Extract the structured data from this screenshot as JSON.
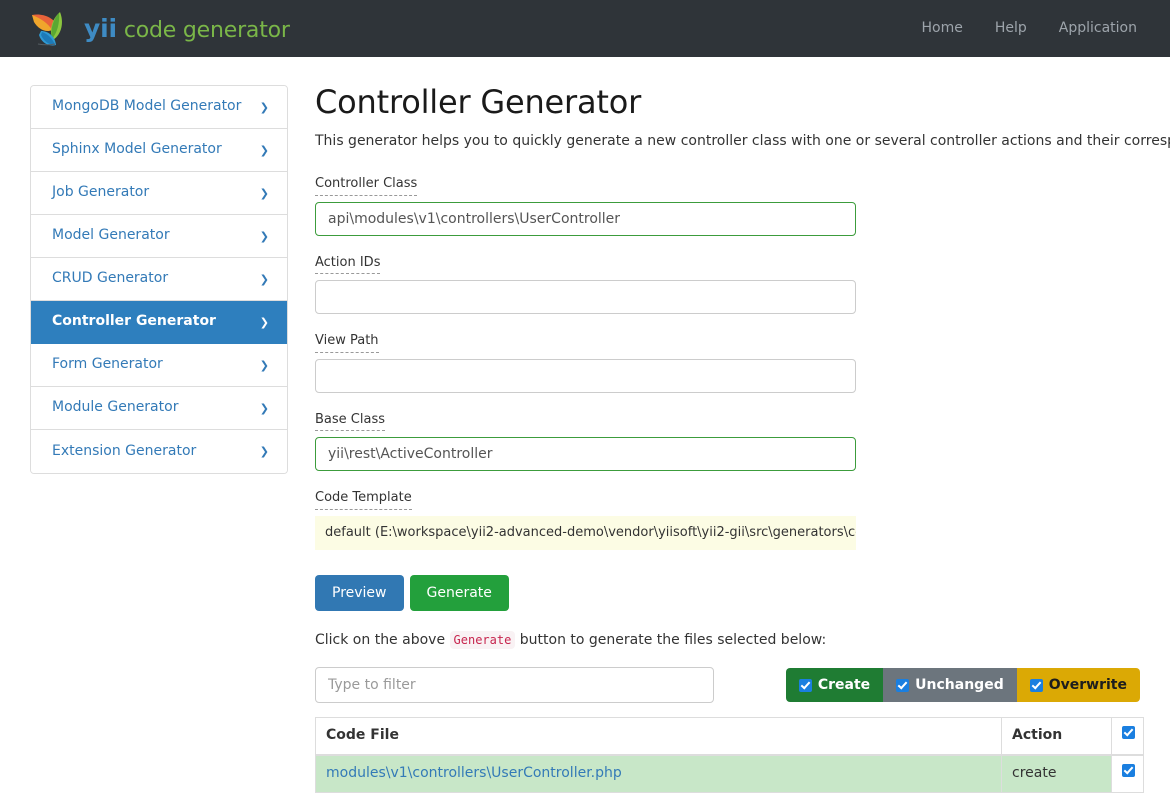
{
  "header": {
    "brand_yii": "yii",
    "brand_suffix": "code generator",
    "logo_icon": "yii-bird-logo",
    "nav": [
      {
        "label": "Home",
        "name": "nav-home"
      },
      {
        "label": "Help",
        "name": "nav-help"
      },
      {
        "label": "Application",
        "name": "nav-application"
      }
    ]
  },
  "sidebar": {
    "items": [
      {
        "label": "MongoDB Model Generator",
        "active": false
      },
      {
        "label": "Sphinx Model Generator",
        "active": false
      },
      {
        "label": "Job Generator",
        "active": false
      },
      {
        "label": "Model Generator",
        "active": false
      },
      {
        "label": "CRUD Generator",
        "active": false
      },
      {
        "label": "Controller Generator",
        "active": true
      },
      {
        "label": "Form Generator",
        "active": false
      },
      {
        "label": "Module Generator",
        "active": false
      },
      {
        "label": "Extension Generator",
        "active": false
      }
    ],
    "chevron_icon": "chevron-right-icon"
  },
  "main": {
    "title": "Controller Generator",
    "description": "This generator helps you to quickly generate a new controller class with one or several controller actions and their corresponding views.",
    "fields": [
      {
        "label": "Controller Class",
        "value": "api\\modules\\v1\\controllers\\UserController",
        "placeholder": "",
        "valid": true
      },
      {
        "label": "Action IDs",
        "value": "",
        "placeholder": "",
        "valid": false
      },
      {
        "label": "View Path",
        "value": "",
        "placeholder": "",
        "valid": false
      },
      {
        "label": "Base Class",
        "value": "yii\\rest\\ActiveController",
        "placeholder": "",
        "valid": true
      }
    ],
    "code_template": {
      "label": "Code Template",
      "value": "default (E:\\workspace\\yii2-advanced-demo\\vendor\\yiisoft\\yii2-gii\\src\\generators\\con…"
    },
    "buttons": {
      "preview": "Preview",
      "generate": "Generate"
    },
    "hint": {
      "prefix": "Click on the above ",
      "code": "Generate",
      "suffix": " button to generate the files selected below:"
    },
    "filter_placeholder": "Type to filter",
    "filter_value": "",
    "toggles": [
      {
        "label": "Create",
        "checked": true,
        "color": "#1f7c33"
      },
      {
        "label": "Unchanged",
        "checked": true,
        "color": "#6c757d"
      },
      {
        "label": "Overwrite",
        "checked": true,
        "color": "#dba905"
      }
    ],
    "table": {
      "headers": {
        "file": "Code File",
        "action": "Action"
      },
      "header_checked": true,
      "rows": [
        {
          "file": "modules\\v1\\controllers\\UserController.php",
          "action": "create",
          "checked": true,
          "state": "create"
        }
      ]
    }
  }
}
